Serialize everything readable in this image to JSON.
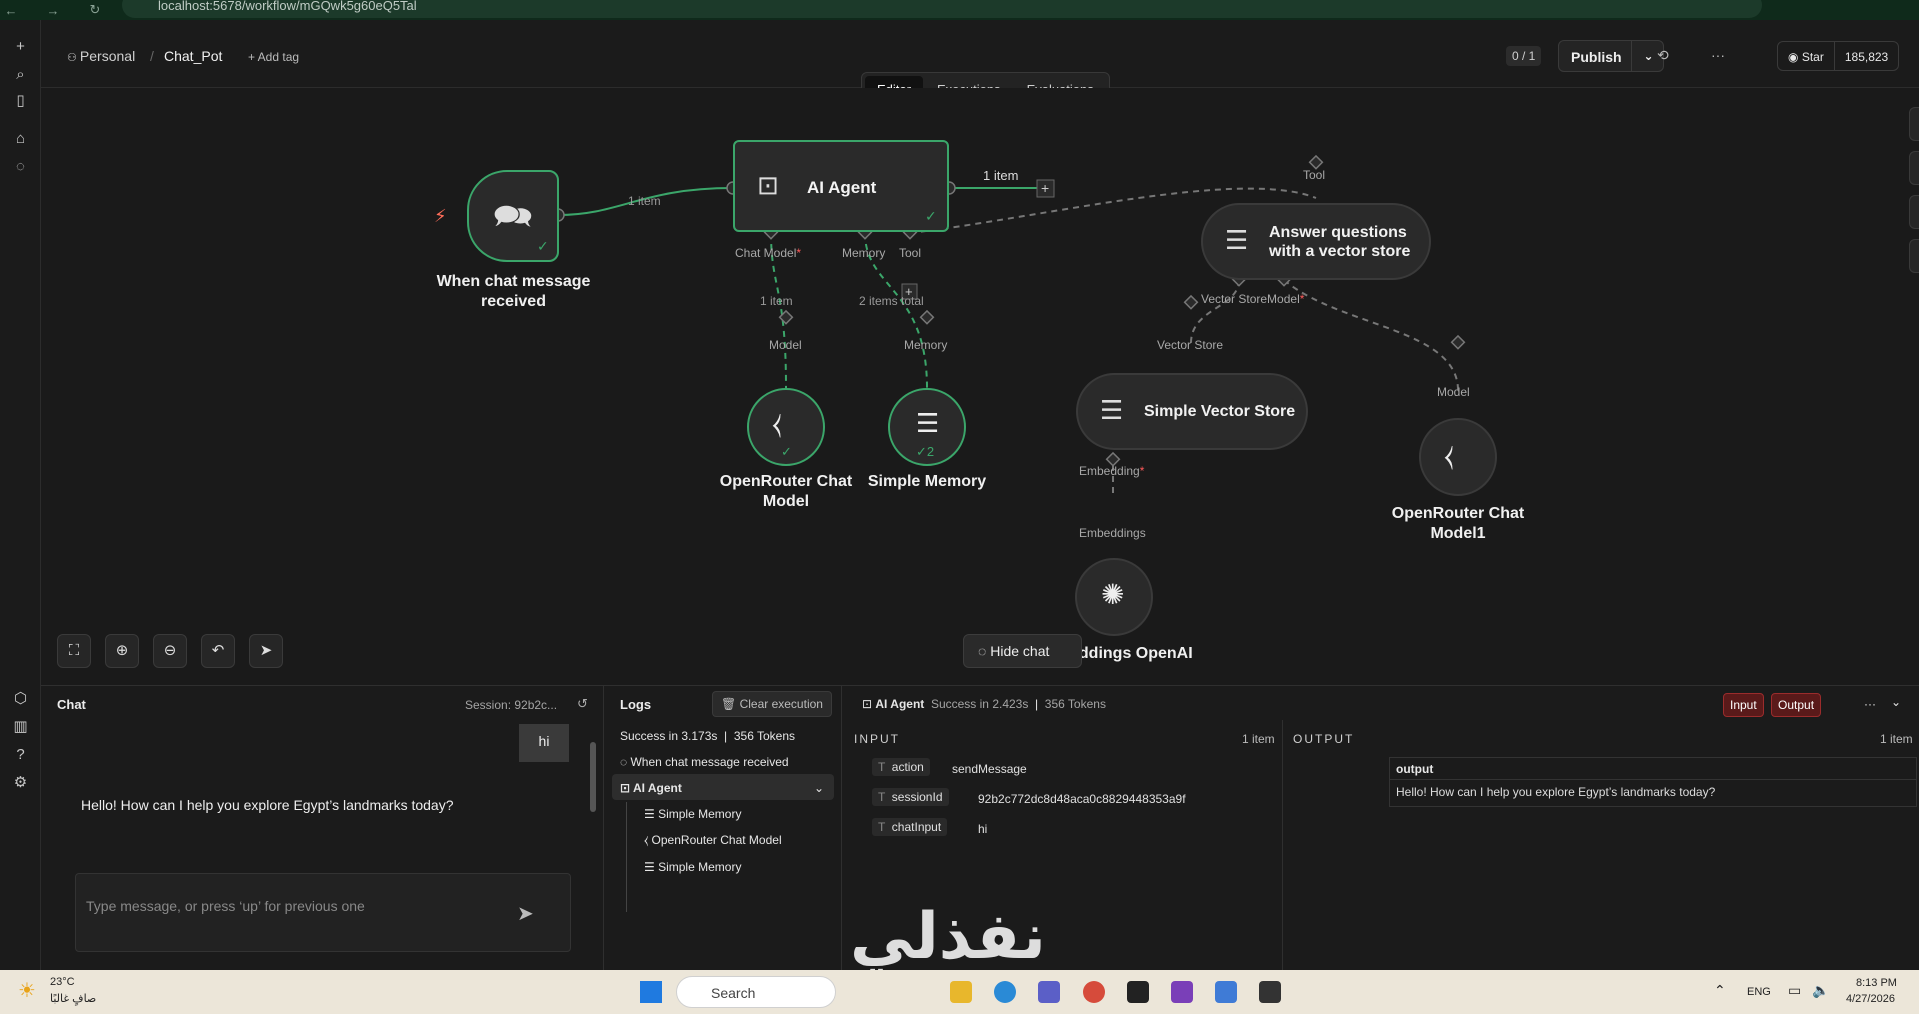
{
  "browser": {
    "url": "localhost:5678/workflow/mGQwk5g60eQ5Tal"
  },
  "header": {
    "owner": "Personal",
    "workflow_name": "Chat_Pot",
    "add_tag": "+ Add tag",
    "counter": "0 / 1",
    "publish_label": "Publish",
    "star_label": "Star",
    "star_count": "185,823",
    "tabs": [
      "Editor",
      "Executions",
      "Evaluations"
    ],
    "active_tab": "Editor"
  },
  "canvas": {
    "nodes": {
      "trigger": "When chat message received",
      "agent": "AI Agent",
      "answer": "Answer questions with a vector store",
      "chat_model": "OpenRouter Chat Model",
      "memory": "Simple Memory",
      "vector_store": "Simple Vector Store",
      "chat_model_1": "OpenRouter Chat Model1",
      "embeddings": "Embeddings OpenAI"
    },
    "labels": {
      "item_1": "1 item",
      "item_out": "1 item",
      "chat_model": "Chat Model",
      "memory": "Memory",
      "tool": "Tool",
      "item_model": "1 item",
      "items_total": "2 items total",
      "model": "Model",
      "memory_in": "Memory",
      "tool_in": "Tool",
      "vector_store_out": "Vector Store",
      "model_out": "Model",
      "vector_store_in": "Vector Store",
      "model_in": "Model",
      "embedding": "Embedding",
      "embeddings_in": "Embeddings",
      "memory_count": "2"
    },
    "hide_chat": "Hide chat"
  },
  "chat": {
    "title": "Chat",
    "session": "Session: 92b2c...",
    "user_message": "hi",
    "bot_message": "Hello! How can I help you explore Egypt’s landmarks today?",
    "input_placeholder": "Type message, or press ‘up’ for previous one"
  },
  "logs": {
    "title": "Logs",
    "clear": "Clear execution",
    "summary": "Success in 3.173s",
    "tokens": "356 Tokens",
    "entries": [
      "When chat message received",
      "AI Agent",
      "Simple Memory",
      "OpenRouter Chat Model",
      "Simple Memory"
    ]
  },
  "detail": {
    "node": "AI Agent",
    "status": "Success in 2.423s",
    "tokens": "356 Tokens",
    "input_btn": "Input",
    "output_btn": "Output",
    "input_head": "INPUT",
    "input_count": "1 item",
    "output_head": "OUTPUT",
    "output_count": "1 item",
    "fields": [
      {
        "key": "action",
        "value": "sendMessage"
      },
      {
        "key": "sessionId",
        "value": "92b2c772dc8d48aca0c8829448353a9f"
      },
      {
        "key": "chatInput",
        "value": "hi"
      }
    ],
    "output_key": "output",
    "output_value": "Hello! How can I help you explore Egypt’s landmarks today?"
  },
  "watermark": "نفذلي",
  "taskbar": {
    "temp": "23°C",
    "weather": "صافٍ غالبًا",
    "search": "Search",
    "lang": "ENG",
    "time": "8:13 PM",
    "date": "4/27/2026"
  },
  "colors": {
    "accent_green": "#3ba66a",
    "badge_red": "#9b2c2c"
  }
}
